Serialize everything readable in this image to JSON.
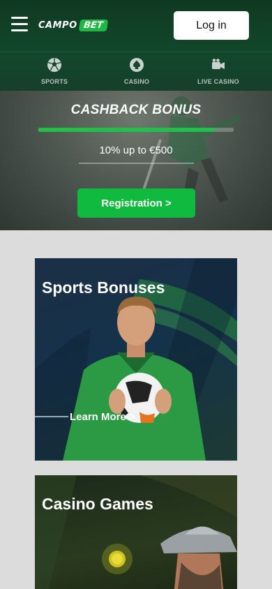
{
  "header": {
    "logo": {
      "word1": "CAMPO",
      "word2": "BET"
    },
    "login_label": "Log in"
  },
  "nav": {
    "items": [
      {
        "label": "SPORTS",
        "icon": "soccer-ball-icon"
      },
      {
        "label": "CASINO",
        "icon": "spade-icon"
      },
      {
        "label": "LIVE CASINO",
        "icon": "video-camera-icon"
      }
    ]
  },
  "hero": {
    "title": "CASHBACK BONUS",
    "subtitle": "10% up to €500",
    "button_label": "Registration >",
    "progress": 0.9
  },
  "cards": [
    {
      "title": "Sports Bonuses",
      "link_label": "Learn More >"
    },
    {
      "title": "Casino Games"
    }
  ],
  "colors": {
    "header_bg": "#13472b",
    "accent_green": "#0fba3e",
    "logo_badge": "#1db944",
    "page_bg": "#dcdcdc"
  }
}
